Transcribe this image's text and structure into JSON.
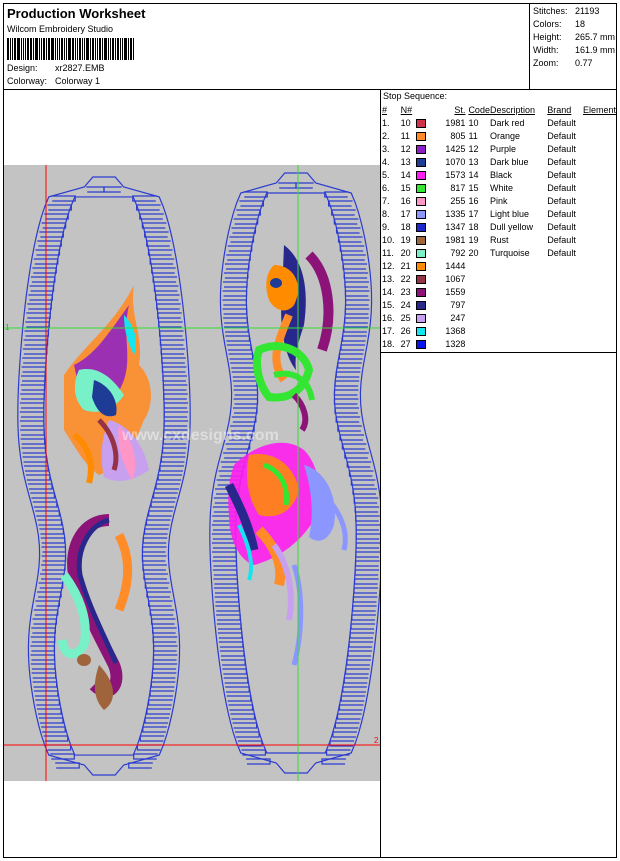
{
  "header": {
    "title": "Production Worksheet",
    "vendor": "Wilcom Embroidery Studio",
    "design_label": "Design:",
    "design_value": "xr2827.EMB",
    "colorway_label": "Colorway:",
    "colorway_value": "Colorway 1"
  },
  "stats": [
    {
      "label": "Stitches:",
      "value": "21193"
    },
    {
      "label": "Colors:",
      "value": "18"
    },
    {
      "label": "Height:",
      "value": "265.7 mm"
    },
    {
      "label": "Width:",
      "value": "161.9 mm"
    },
    {
      "label": "Zoom:",
      "value": "0.77"
    }
  ],
  "preview": {
    "watermark": "www.cxdesigns.com",
    "marker_1": "1",
    "marker_2": "2",
    "colors": {
      "background": "#c3c3c3",
      "outline": "#2b3bd0",
      "guide_red": "#ff0000",
      "guide_green": "#33dd33"
    }
  },
  "stop_sequence": {
    "title": "Stop Sequence:",
    "columns": [
      "#",
      "N#",
      "St.",
      "Code",
      "Description",
      "Brand",
      "Element"
    ],
    "rows": [
      {
        "num": "1.",
        "n": "10",
        "color": "#d0324a",
        "st": "1981",
        "code": "10",
        "desc": "Dark red",
        "brand": "Default"
      },
      {
        "num": "2.",
        "n": "11",
        "color": "#ff8c28",
        "st": "805",
        "code": "11",
        "desc": "Orange",
        "brand": "Default"
      },
      {
        "num": "3.",
        "n": "12",
        "color": "#8c1ec8",
        "st": "1425",
        "code": "12",
        "desc": "Purple",
        "brand": "Default"
      },
      {
        "num": "4.",
        "n": "13",
        "color": "#1e3c96",
        "st": "1070",
        "code": "13",
        "desc": "Dark blue",
        "brand": "Default"
      },
      {
        "num": "5.",
        "n": "14",
        "color": "#ff1ef0",
        "st": "1573",
        "code": "14",
        "desc": "Black",
        "brand": "Default"
      },
      {
        "num": "6.",
        "n": "15",
        "color": "#32e632",
        "st": "817",
        "code": "15",
        "desc": "White",
        "brand": "Default"
      },
      {
        "num": "7.",
        "n": "16",
        "color": "#ff96c8",
        "st": "255",
        "code": "16",
        "desc": "Pink",
        "brand": "Default"
      },
      {
        "num": "8.",
        "n": "17",
        "color": "#8c96ff",
        "st": "1335",
        "code": "17",
        "desc": "Light blue",
        "brand": "Default"
      },
      {
        "num": "9.",
        "n": "18",
        "color": "#1e28c8",
        "st": "1347",
        "code": "18",
        "desc": "Dull yellow",
        "brand": "Default"
      },
      {
        "num": "10.",
        "n": "19",
        "color": "#a0643c",
        "st": "1981",
        "code": "19",
        "desc": "Rust",
        "brand": "Default"
      },
      {
        "num": "11.",
        "n": "20",
        "color": "#78f0c8",
        "st": "792",
        "code": "20",
        "desc": "Turquoise",
        "brand": "Default"
      },
      {
        "num": "12.",
        "n": "21",
        "color": "#ff8c00",
        "st": "1444",
        "code": "",
        "desc": "",
        "brand": ""
      },
      {
        "num": "13.",
        "n": "22",
        "color": "#963246",
        "st": "1067",
        "code": "",
        "desc": "",
        "brand": ""
      },
      {
        "num": "14.",
        "n": "23",
        "color": "#8c1478",
        "st": "1559",
        "code": "",
        "desc": "",
        "brand": ""
      },
      {
        "num": "15.",
        "n": "24",
        "color": "#28288c",
        "st": "797",
        "code": "",
        "desc": "",
        "brand": ""
      },
      {
        "num": "16.",
        "n": "25",
        "color": "#c8a0f0",
        "st": "247",
        "code": "",
        "desc": "",
        "brand": ""
      },
      {
        "num": "17.",
        "n": "26",
        "color": "#14e6f0",
        "st": "1368",
        "code": "",
        "desc": "",
        "brand": ""
      },
      {
        "num": "18.",
        "n": "27",
        "color": "#0a14e6",
        "st": "1328",
        "code": "",
        "desc": "",
        "brand": ""
      }
    ]
  }
}
